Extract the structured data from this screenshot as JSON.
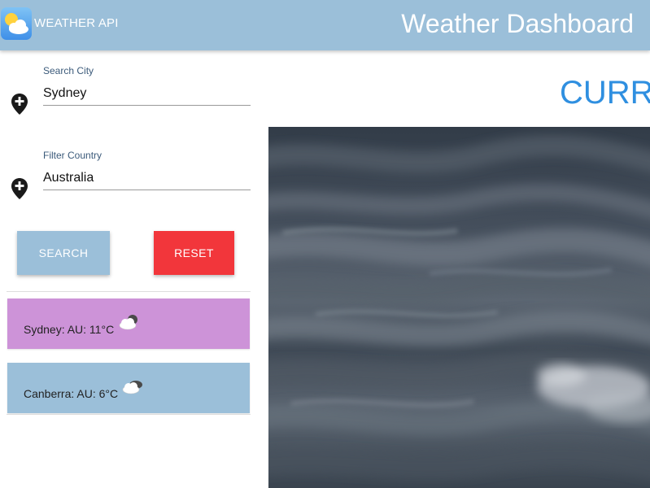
{
  "header": {
    "app_name": "WEATHER API",
    "title": "Weather Dashboard"
  },
  "search": {
    "city_label": "Search City",
    "city_value": "Sydney",
    "country_label": "Filter Country",
    "country_value": "Australia",
    "search_button": "SEARCH",
    "reset_button": "RESET"
  },
  "results": [
    {
      "text": "Sydney: AU: 11°C",
      "icon": "partly-cloudy-night-icon",
      "color": "#cd93d8"
    },
    {
      "text": "Canberra: AU: 6°C",
      "icon": "cloudy-icon",
      "color": "#9bbfd9"
    }
  ],
  "main": {
    "current_heading": "CURR",
    "hero_image": "storm-clouds-image"
  },
  "colors": {
    "header": "#9bbfd9",
    "search_button": "#9bbfd9",
    "reset_button": "#f2363b",
    "heading": "#2f8fe0"
  }
}
